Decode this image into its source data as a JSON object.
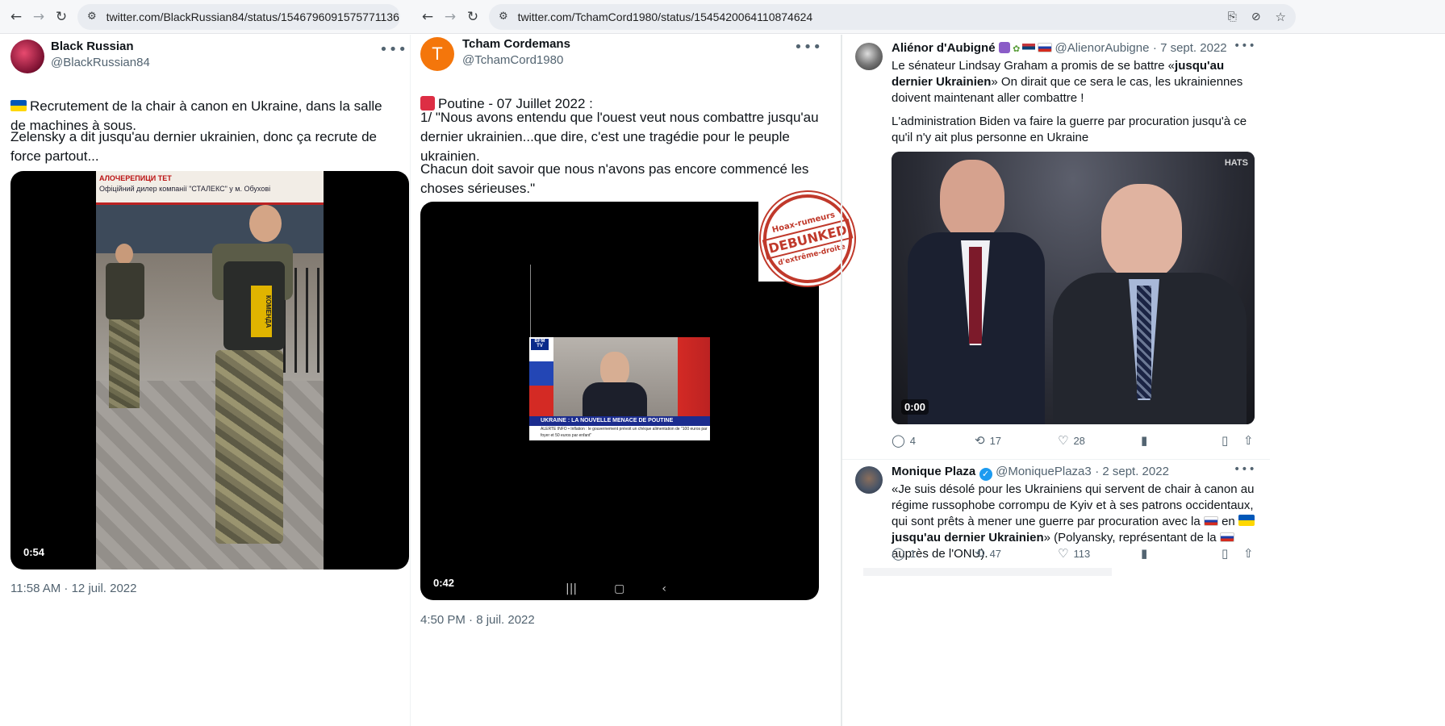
{
  "browser_left": {
    "url": "twitter.com/BlackRussian84/status/1546796091575771136"
  },
  "browser_right": {
    "url": "twitter.com/TchamCord1980/status/1545420064110874624"
  },
  "tweet1": {
    "name": "Black Russian",
    "handle": "@BlackRussian84",
    "text_line1": "Recrutement de la chair à canon en Ukraine, dans la salle de machines à sous.",
    "text_line2": "Zelensky a dit jusqu'au dernier ukrainien, donc ça recrute de force partout...",
    "duration": "0:54",
    "timestamp": "11:58 AM · 12 juil. 2022",
    "video_sign": "АЛОЧЕРЕПИЦИ ТЕТ",
    "video_sign2": "Офіційний дилер компанії \"СТАЛЕКС\" у м. Обухові",
    "vest_label": "КОМЕНДА"
  },
  "tweet2": {
    "avatar_letter": "T",
    "name": "Tcham Cordemans",
    "handle": "@TchamCord1980",
    "text_title": "Poutine - 07 Juillet 2022 :",
    "text_p1": "1/ \"Nous avons entendu que l'ouest veut nous combattre jusqu'au dernier ukrainien...que dire, c'est une tragédie pour le peuple ukrainien.",
    "text_p2": "Chacun doit savoir que nous n'avons pas encore commencé les choses sérieuses.\"",
    "duration": "0:42",
    "timestamp": "4:50 PM · 8 juil. 2022",
    "tv_banner": "UKRAINE : LA NOUVELLE MENACE DE POUTINE",
    "tv_alert": "ALERTE INFO • Inflation : le gouvernement prévoit un chèque alimentation de \"100 euros par foyer et 50 euros par enfant\"",
    "tv_channel": "BFM TV",
    "stamp_top": "Hoax-rumeurs",
    "stamp_mid": "DEBUNKED",
    "stamp_bot": "d'extrême-droite"
  },
  "reply1": {
    "name": "Aliénor d'Aubigné",
    "handle": "@AlienorAubigne",
    "date": "· 7 sept. 2022",
    "text_a": "Le sénateur Lindsay Graham a promis de se battre «",
    "text_b": "jusqu'au dernier Ukrainien",
    "text_c": "» On dirait que ce sera le cas, les ukrainiennes doivent maintenant aller combattre !",
    "text_d": "L'administration Biden va faire la guerre par procuration jusqu'à ce qu'il n'y ait plus personne en Ukraine",
    "duration": "0:00",
    "video_logo": "HATS",
    "replies": "4",
    "retweets": "17",
    "likes": "28"
  },
  "reply2": {
    "name": "Monique Plaza",
    "handle": "@MoniquePlaza3",
    "date": "· 2 sept. 2022",
    "text_a": "«Je suis désolé pour les Ukrainiens qui servent de chair à canon au régime russophobe corrompu de Kyiv et à ses patrons occidentaux, qui sont prêts à mener une guerre par procuration avec la",
    "text_b": "en",
    "text_c": "jusqu'au dernier Ukrainien",
    "text_d": "» (Polyansky, représentant de la",
    "text_e": "auprès de l'ONU).",
    "replies": "1",
    "retweets": "47",
    "likes": "113"
  },
  "icons": {
    "back": "←",
    "forward": "→",
    "reload": "↻",
    "site": "⚙",
    "more": "•••",
    "reply": "◯",
    "retweet": "⟲",
    "like": "♡",
    "views": "▮",
    "bookmark": "▯",
    "share": "⇧"
  }
}
